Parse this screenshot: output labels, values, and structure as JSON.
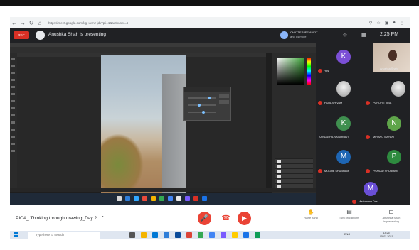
{
  "browser": {
    "url": "https://meet.google.com/kgj-xvmz-jdv?pli=1&authuser=4"
  },
  "meet_header": {
    "recording_label": "REC",
    "presenter_text": "Anushka Shah is presenting",
    "chip_name": "CHATTERJEE ANKIT...",
    "chip_more": "and 54 more",
    "clock": "2:25 PM"
  },
  "participants": [
    {
      "name": "Yes",
      "initial": "K",
      "color": "#7b4fd6"
    },
    {
      "name": "Anushka Shah",
      "initial": "",
      "color": ""
    },
    {
      "name": "PATIL SHIVAM",
      "initial": "",
      "color": ""
    },
    {
      "name": "PUROHIT JINA",
      "initial": "",
      "color": ""
    },
    {
      "name": "KANDATHIL VAISHNAVI",
      "initial": "K",
      "color": "#3f8f4f"
    },
    {
      "name": "MIRANO MAYANI",
      "initial": "N",
      "color": "#5fa54a"
    },
    {
      "name": "MOGHE SHUBHAM",
      "initial": "M",
      "color": "#1e66b4"
    },
    {
      "name": "PRASAD SHUBHAM",
      "initial": "P",
      "color": "#2e8b3f"
    },
    {
      "name": "Madhurima Das",
      "initial": "M",
      "color": "#6a4fd6"
    }
  ],
  "bottom_bar": {
    "meeting_title": "PICA_ Thinking through drawing_Day 2",
    "raise_hand": "Raise hand",
    "captions": "Turn on captions",
    "presenting_line1": "Anushka Shah",
    "presenting_line2": "is presenting"
  },
  "windows": {
    "search_placeholder": "Type here to search",
    "tray": "ENG",
    "time": "14:25",
    "date": "05-02-2021"
  }
}
